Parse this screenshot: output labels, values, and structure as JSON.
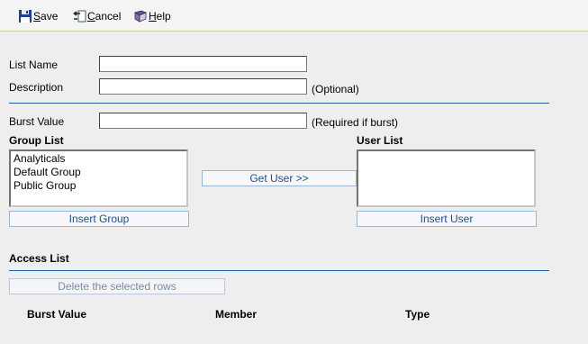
{
  "toolbar": {
    "save": {
      "accel": "S",
      "rest": "ave",
      "icon": "floppy-disk-icon"
    },
    "cancel": {
      "accel": "C",
      "rest": "ancel",
      "icon": "undo-arrow-icon"
    },
    "help": {
      "accel": "H",
      "rest": "elp",
      "icon": "help-book-icon"
    }
  },
  "form": {
    "list_name_label": "List Name",
    "list_name_value": "",
    "description_label": "Description",
    "description_value": "",
    "description_hint": "(Optional)",
    "burst_value_label": "Burst Value",
    "burst_value_value": "",
    "burst_value_hint": "(Required if burst)"
  },
  "group_list": {
    "title": "Group List",
    "items": [
      "Analyticals",
      "Default Group",
      "Public Group"
    ],
    "insert_button": "Insert Group"
  },
  "get_user_button": "Get User >>",
  "user_list": {
    "title": "User List",
    "items": [],
    "insert_button": "Insert User"
  },
  "access_list": {
    "title": "Access List",
    "delete_button": "Delete the selected rows",
    "columns": [
      "Burst Value",
      "Member",
      "Type"
    ]
  },
  "colors": {
    "rule": "#1f5fa0",
    "button_text": "#1c4f8c"
  }
}
